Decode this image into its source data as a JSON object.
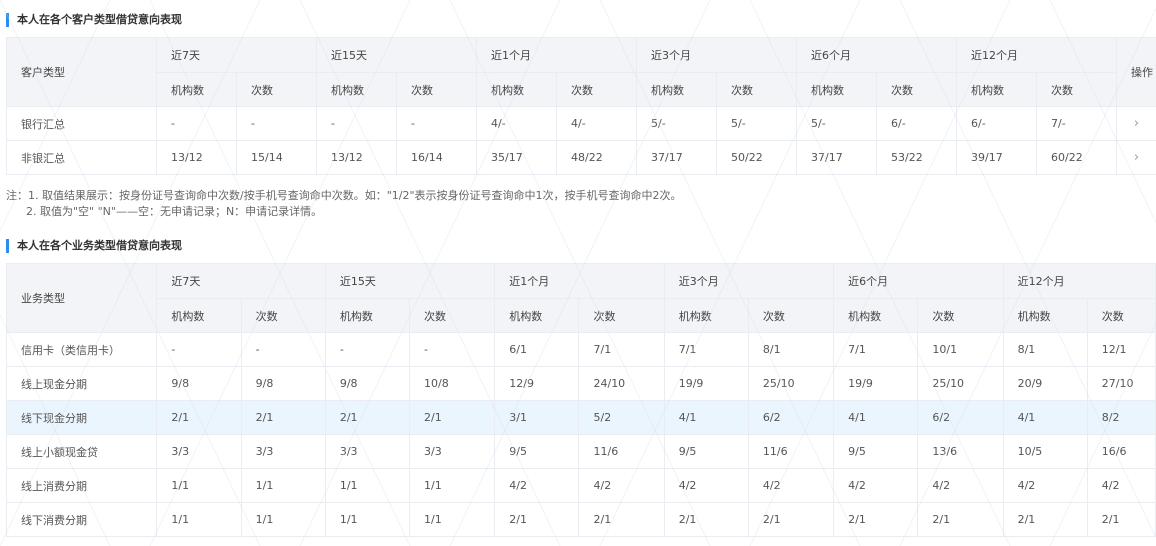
{
  "section1": {
    "title": "本人在各个客户类型借贷意向表现",
    "row_header": "客户类型",
    "periods": [
      "近7天",
      "近15天",
      "近1个月",
      "近3个月",
      "近6个月",
      "近12个月"
    ],
    "sub_headers": [
      "机构数",
      "次数"
    ],
    "action_header": "操作",
    "rows": [
      {
        "label": "银行汇总",
        "cells": [
          "-",
          "-",
          "-",
          "-",
          "4/-",
          "4/-",
          "5/-",
          "5/-",
          "5/-",
          "6/-",
          "6/-",
          "7/-"
        ],
        "action": "›"
      },
      {
        "label": "非银汇总",
        "cells": [
          "13/12",
          "15/14",
          "13/12",
          "16/14",
          "35/17",
          "48/22",
          "37/17",
          "50/22",
          "37/17",
          "53/22",
          "39/17",
          "60/22"
        ],
        "action": "›"
      }
    ]
  },
  "notes": {
    "line1": "注：1. 取值结果展示：按身份证号查询命中次数/按手机号查询命中次数。如：\"1/2\"表示按身份证号查询命中1次，按手机号查询命中2次。",
    "line2": "2. 取值为\"空\" \"N\"——空：无申请记录；N：申请记录详情。"
  },
  "section2": {
    "title": "本人在各个业务类型借贷意向表现",
    "row_header": "业务类型",
    "periods": [
      "近7天",
      "近15天",
      "近1个月",
      "近3个月",
      "近6个月",
      "近12个月"
    ],
    "sub_headers": [
      "机构数",
      "次数"
    ],
    "rows": [
      {
        "label": "信用卡（类信用卡）",
        "cells": [
          "-",
          "-",
          "-",
          "-",
          "6/1",
          "7/1",
          "7/1",
          "8/1",
          "7/1",
          "10/1",
          "8/1",
          "12/1"
        ]
      },
      {
        "label": "线上现金分期",
        "cells": [
          "9/8",
          "9/8",
          "9/8",
          "10/8",
          "12/9",
          "24/10",
          "19/9",
          "25/10",
          "19/9",
          "25/10",
          "20/9",
          "27/10"
        ]
      },
      {
        "label": "线下现金分期",
        "cells": [
          "2/1",
          "2/1",
          "2/1",
          "2/1",
          "3/1",
          "5/2",
          "4/1",
          "6/2",
          "4/1",
          "6/2",
          "4/1",
          "8/2"
        ],
        "highlight": true
      },
      {
        "label": "线上小额现金贷",
        "cells": [
          "3/3",
          "3/3",
          "3/3",
          "3/3",
          "9/5",
          "11/6",
          "9/5",
          "11/6",
          "9/5",
          "13/6",
          "10/5",
          "16/6"
        ]
      },
      {
        "label": "线上消费分期",
        "cells": [
          "1/1",
          "1/1",
          "1/1",
          "1/1",
          "4/2",
          "4/2",
          "4/2",
          "4/2",
          "4/2",
          "4/2",
          "4/2",
          "4/2"
        ]
      },
      {
        "label": "线下消费分期",
        "cells": [
          "1/1",
          "1/1",
          "1/1",
          "1/1",
          "2/1",
          "2/1",
          "2/1",
          "2/1",
          "2/1",
          "2/1",
          "2/1",
          "2/1"
        ]
      }
    ]
  },
  "colors": {
    "accent": "#2d8cf0",
    "header_bg": "#f2f4f7",
    "highlight_row": "#eaf5fd"
  }
}
